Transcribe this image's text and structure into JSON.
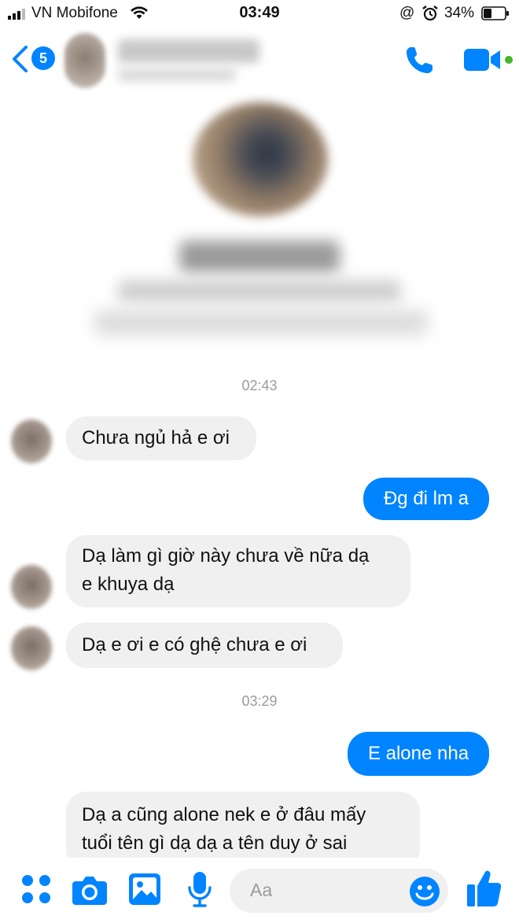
{
  "status_bar": {
    "carrier": "VN Mobifone",
    "time": "03:49",
    "location_symbol": "@",
    "battery": "34%",
    "icons": [
      "signal-icon",
      "wifi-icon",
      "alarm-icon",
      "battery-icon"
    ]
  },
  "header": {
    "back_badge": "5",
    "icons": [
      "back-chevron-icon",
      "phone-icon",
      "video-camera-icon",
      "active-dot-icon"
    ],
    "accent_color": "#0084ff"
  },
  "messages": [
    {
      "type": "timestamp",
      "text": "02:43"
    },
    {
      "type": "incoming",
      "lines": [
        "Chưa ngủ hả e ơi"
      ]
    },
    {
      "type": "outgoing",
      "lines": [
        "Đg đi lm a"
      ]
    },
    {
      "type": "incoming",
      "lines": [
        "Dạ làm gì giờ này chưa về nữa dạ",
        "e khuya dạ"
      ]
    },
    {
      "type": "incoming",
      "lines": [
        "Dạ e ơi e có ghệ chưa e ơi"
      ]
    },
    {
      "type": "timestamp",
      "text": "03:29"
    },
    {
      "type": "outgoing",
      "lines": [
        "E alone nha"
      ]
    },
    {
      "type": "incoming",
      "lines": [
        "Dạ a cũng alone nek e ở đâu mấy",
        "tuổi tên gì dạ dạ a tên duy ở sai"
      ]
    }
  ],
  "composer": {
    "placeholder": "Aa",
    "icons": [
      "apps-icon",
      "camera-icon",
      "gallery-icon",
      "microphone-icon",
      "emoji-icon",
      "thumbs-up-icon"
    ]
  },
  "colors": {
    "outgoing_bubble": "#0084ff",
    "incoming_bubble": "#f1f0f0",
    "timestamp": "#9b9b9b"
  }
}
